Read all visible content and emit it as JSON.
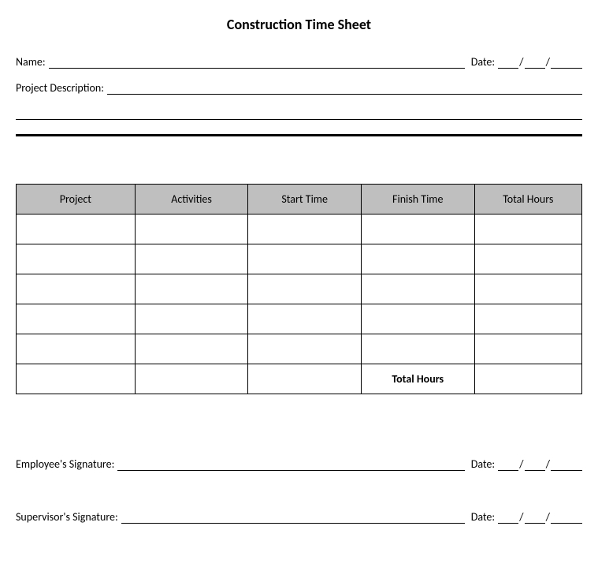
{
  "title": "Construction Time Sheet",
  "header": {
    "name_label": "Name:",
    "date_label": "Date:",
    "project_desc_label": "Project Description:"
  },
  "table": {
    "columns": [
      "Project",
      "Activities",
      "Start Time",
      "Finish Time",
      "Total Hours"
    ],
    "rows": [
      [
        "",
        "",
        "",
        "",
        ""
      ],
      [
        "",
        "",
        "",
        "",
        ""
      ],
      [
        "",
        "",
        "",
        "",
        ""
      ],
      [
        "",
        "",
        "",
        "",
        ""
      ],
      [
        "",
        "",
        "",
        "",
        ""
      ]
    ],
    "total_label": "Total Hours"
  },
  "signatures": {
    "employee_label": "Employee's Signature:",
    "supervisor_label": "Supervisor's Signature:",
    "date_label": "Date:"
  },
  "slash": "/"
}
